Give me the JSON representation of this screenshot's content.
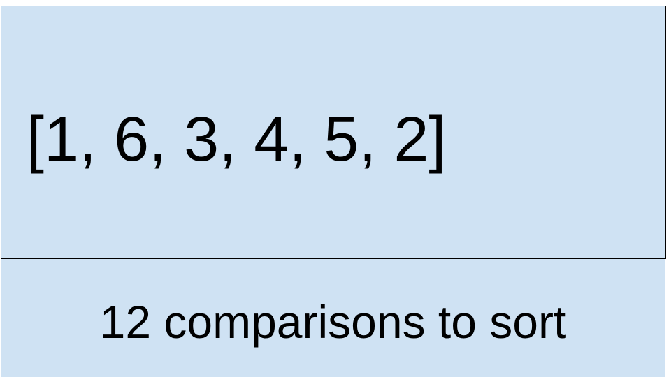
{
  "array_box": {
    "text": "[1, 6, 3, 4, 5, 2]",
    "fill": "#cfe2f3"
  },
  "result_box": {
    "text": "12 comparisons to sort",
    "fill": "#cfe2f3"
  }
}
